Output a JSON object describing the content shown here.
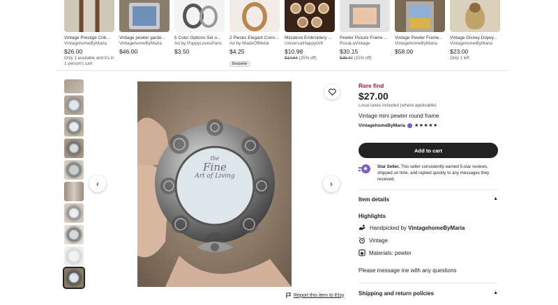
{
  "recommendations": [
    {
      "title": "Vintage Prestige Crib...",
      "shop": "VintagehomeByMaria",
      "price": "$26.00",
      "note": "Only 1 available and it's in 1 person's cart"
    },
    {
      "title": "Vintage pewter garde...",
      "shop": "VintagehomeByMaria",
      "price": "$46.00"
    },
    {
      "title": "5 Color Options Set o...",
      "shop": "Ad by PoppyLovesParis",
      "price": "$3.50"
    },
    {
      "title": "2 Pieces Elegant Conn...",
      "shop": "Ad by MadeOfMetal",
      "price": "$4.25",
      "badge": "Bestseller"
    },
    {
      "title": "Miniature Embroidery ...",
      "shop": "UniversalHappyGift",
      "price": "$10.98",
      "old_price": "$14.64",
      "discount": "(25% off)"
    },
    {
      "title": "Pewter Picture Frame ...",
      "shop": "RosaLaVintage",
      "price": "$30.15",
      "old_price": "$35.47",
      "discount": "(15% off)"
    },
    {
      "title": "Vintage Pewter Frame...",
      "shop": "VintagehomeByMaria",
      "price": "$58.00"
    },
    {
      "title": "Vintage Disney Dopey...",
      "shop": "VintagehomeByMaria",
      "price": "$23.00",
      "note": "Only 1 left"
    }
  ],
  "listing": {
    "rare": "Rare find",
    "price": "$27.00",
    "tax": "Local taxes included (where applicable)",
    "title": "Vintage mini pewter round frame",
    "seller": "VintagehomeByMaria",
    "stars": "★★★★★",
    "add_to_cart": "Add to cart",
    "star_seller_label": "Star Seller.",
    "star_seller_text": " This seller consistently earned 5-star reviews, shipped on time, and replied quickly to any messages they received.",
    "item_details": "Item details",
    "highlights": "Highlights",
    "handpicked_prefix": "Handpicked by ",
    "handpicked_shop": "VintagehomeByMaria",
    "vintage": "Vintage",
    "materials": "Materials: pewter",
    "message": "Please message me with any questions",
    "shipping": "Shipping and return policies",
    "report": "Report this item to Etsy"
  },
  "image_text": {
    "line1": "the",
    "line2": "Fine",
    "line3": "Art of Living"
  },
  "thumbnail_count": 10,
  "active_thumbnail": 10,
  "colors": {
    "accent_red": "#a61a2e",
    "button_dark": "#222222",
    "star_seller_purple": "#7f5bc8"
  }
}
